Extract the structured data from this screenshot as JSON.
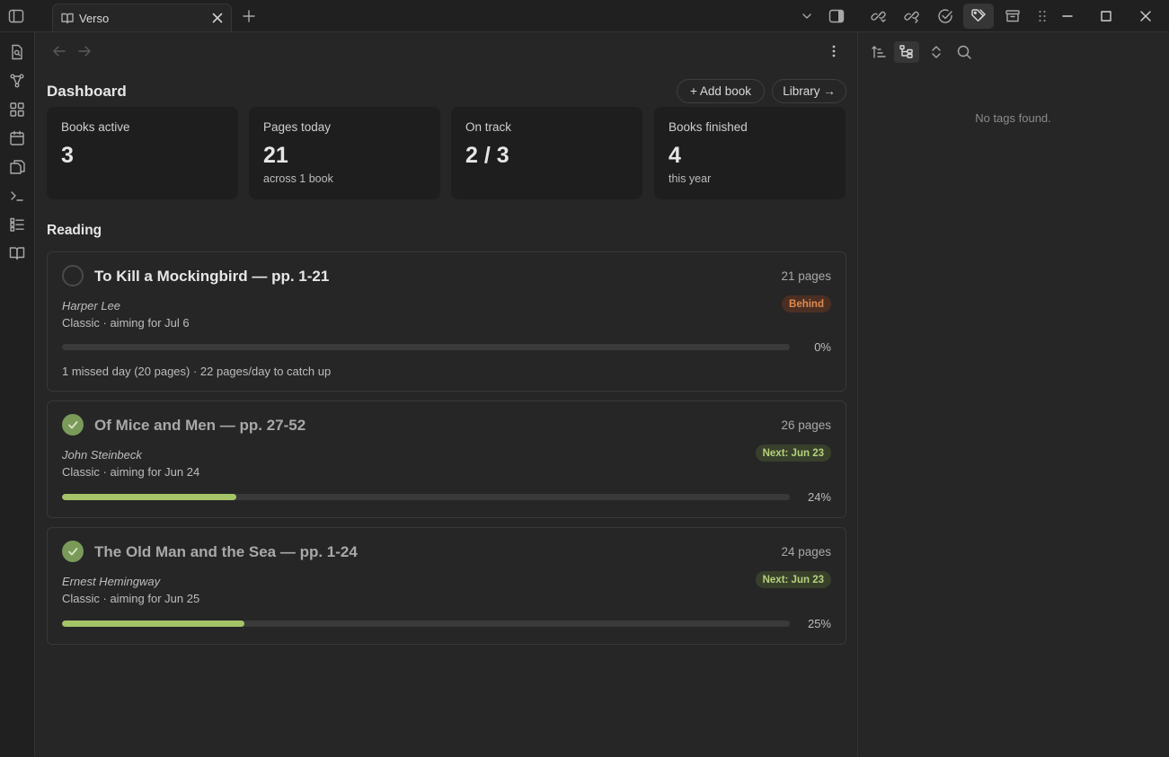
{
  "tab": {
    "title": "Verso"
  },
  "main": {
    "dashboard_title": "Dashboard",
    "add_book_label": "+ Add book",
    "library_label": "Library →",
    "stats": [
      {
        "label": "Books active",
        "value": "3",
        "sub": ""
      },
      {
        "label": "Pages today",
        "value": "21",
        "sub": "across 1 book"
      },
      {
        "label": "On track",
        "value": "2 / 3",
        "sub": ""
      },
      {
        "label": "Books finished",
        "value": "4",
        "sub": "this year"
      }
    ],
    "reading_title": "Reading",
    "books": [
      {
        "title": "To Kill a Mockingbird — pp. 1-21",
        "pages": "21 pages",
        "author": "Harper Lee",
        "meta": "Classic · aiming for Jul 6",
        "badge": "Behind",
        "progress": 0,
        "pct": "0%",
        "note": "1 missed day (20 pages) · 22 pages/day to catch up",
        "done": false
      },
      {
        "title": "Of Mice and Men — pp. 27-52",
        "pages": "26 pages",
        "author": "John Steinbeck",
        "meta": "Classic · aiming for Jun 24",
        "badge": "Next: Jun 23",
        "progress": 0.24,
        "pct": "24%",
        "done": true
      },
      {
        "title": "The Old Man and the Sea — pp. 1-24",
        "pages": "24 pages",
        "author": "Ernest Hemingway",
        "meta": "Classic · aiming for Jun 25",
        "badge": "Next: Jun 23",
        "progress": 0.25,
        "pct": "25%",
        "done": true
      }
    ]
  },
  "right_panel": {
    "empty_text": "No tags found."
  },
  "colors": {
    "accent_green": "#a5c468",
    "behind_orange": "#e08a4e",
    "check_green": "#7a9a5a"
  }
}
